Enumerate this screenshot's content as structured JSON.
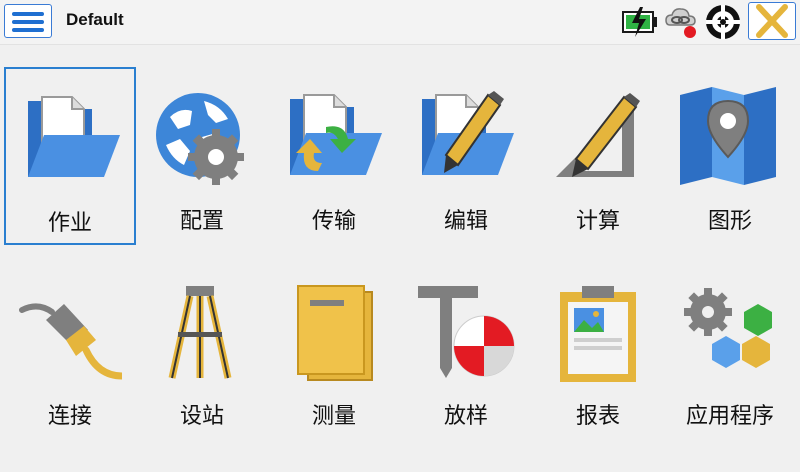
{
  "header": {
    "title": "Default"
  },
  "status_icons": [
    "battery-charging-icon",
    "cloud-link-icon",
    "gnss-status-icon"
  ],
  "tiles": [
    {
      "label": "作业",
      "icon": "open-folder-icon",
      "selected": true
    },
    {
      "label": "配置",
      "icon": "globe-gear-icon"
    },
    {
      "label": "传输",
      "icon": "folder-transfer-icon"
    },
    {
      "label": "编辑",
      "icon": "folder-pencil-icon"
    },
    {
      "label": "计算",
      "icon": "triangle-pencil-icon"
    },
    {
      "label": "图形",
      "icon": "map-pin-icon"
    },
    {
      "label": "连接",
      "icon": "cable-icon"
    },
    {
      "label": "设站",
      "icon": "tripod-icon"
    },
    {
      "label": "测量",
      "icon": "book-icon"
    },
    {
      "label": "放样",
      "icon": "stakeout-target-icon"
    },
    {
      "label": "报表",
      "icon": "clipboard-report-icon"
    },
    {
      "label": "应用程序",
      "icon": "apps-gear-icon"
    }
  ],
  "colors": {
    "accent": "#2a7fd0",
    "folder": "#3d86d8",
    "gold": "#e5b53c",
    "gray": "#7f7f7f",
    "red": "#e31b23"
  }
}
